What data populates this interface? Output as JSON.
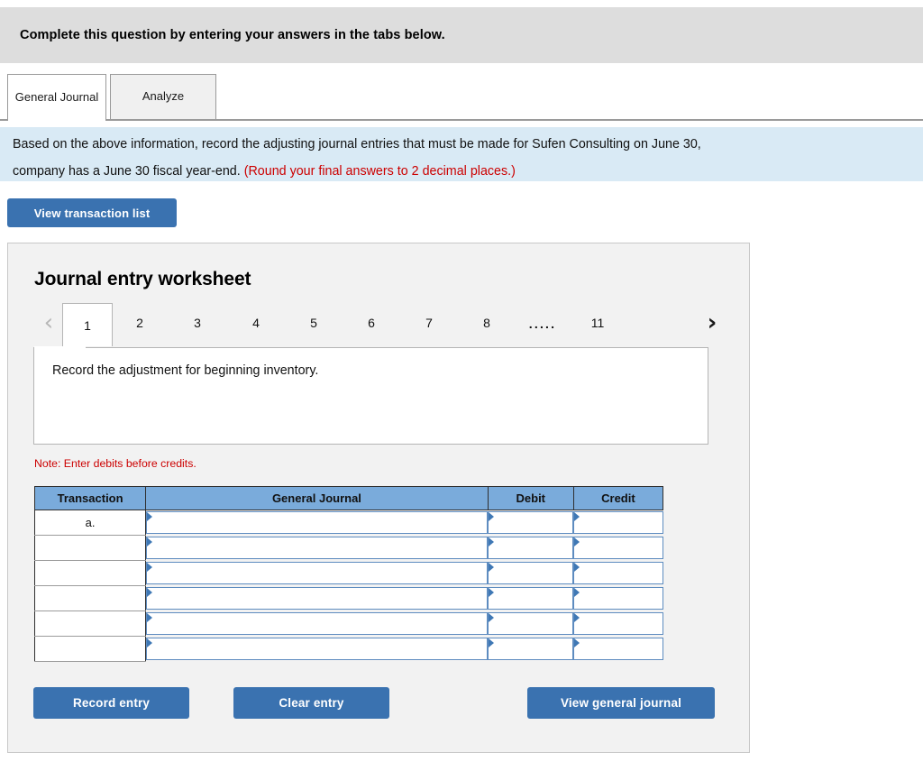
{
  "banner": {
    "text": "Complete this question by entering your answers in the tabs below."
  },
  "tabs": [
    {
      "id": "general-journal",
      "label": "General Journal",
      "active": true
    },
    {
      "id": "analyze",
      "label": "Analyze",
      "active": false
    }
  ],
  "instructions": {
    "line1_part1": "Based on the above information, record the adjusting journal entries that must be made for Sufen Consulting on June 30,",
    "line2_part1": "company has a June 30 fiscal year-end. ",
    "line2_red": "(Round your final answers to 2 decimal places.)"
  },
  "toolbar": {
    "view_transaction_list_label": "View transaction list"
  },
  "worksheet": {
    "title": "Journal entry worksheet",
    "pager": {
      "prev_icon": "chevron-left-icon",
      "next_icon": "chevron-right-icon",
      "pages": [
        "1",
        "2",
        "3",
        "4",
        "5",
        "6",
        "7",
        "8"
      ],
      "ellipsis": ".....",
      "last_page": "11",
      "active_page": "1"
    },
    "prompt": "Record the adjustment for beginning inventory.",
    "note": "Note: Enter debits before credits.",
    "table": {
      "headers": [
        "Transaction",
        "General Journal",
        "Debit",
        "Credit"
      ],
      "rows": [
        {
          "transaction": "a.",
          "general_journal": "",
          "debit": "",
          "credit": ""
        },
        {
          "transaction": "",
          "general_journal": "",
          "debit": "",
          "credit": ""
        },
        {
          "transaction": "",
          "general_journal": "",
          "debit": "",
          "credit": ""
        },
        {
          "transaction": "",
          "general_journal": "",
          "debit": "",
          "credit": ""
        },
        {
          "transaction": "",
          "general_journal": "",
          "debit": "",
          "credit": ""
        },
        {
          "transaction": "",
          "general_journal": "",
          "debit": "",
          "credit": ""
        }
      ]
    },
    "actions": {
      "record_entry_label": "Record entry",
      "clear_entry_label": "Clear entry",
      "view_general_journal_label": "View general journal"
    }
  },
  "colors": {
    "banner_bg": "#dddddd",
    "instruction_bg": "#d9eaf5",
    "accent_blue": "#3a72b0",
    "table_header_blue": "#7aabdb",
    "warning_red": "#cc0000",
    "panel_bg": "#f2f2f2"
  }
}
